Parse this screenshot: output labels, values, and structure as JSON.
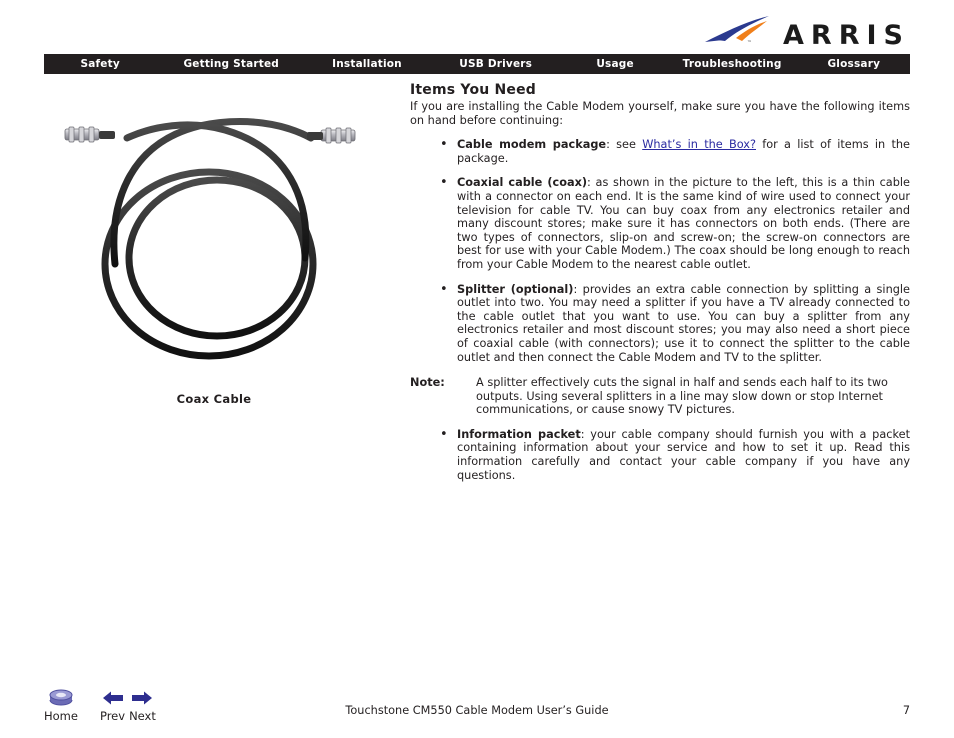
{
  "brand": {
    "name": "ARRIS",
    "swoosh_blue": "#2b3a8f",
    "swoosh_orange": "#f07f1a",
    "wordmark_color": "#1b1b1b"
  },
  "nav": {
    "background": "#231f20",
    "text_color": "#ffffff",
    "items": [
      {
        "label": "Safety"
      },
      {
        "label": "Getting Started"
      },
      {
        "label": "Installation"
      },
      {
        "label": "USB Drivers"
      },
      {
        "label": "Usage"
      },
      {
        "label": "Troubleshooting"
      },
      {
        "label": "Glossary"
      }
    ]
  },
  "figure": {
    "caption": "Coax Cable",
    "alt": "coax-cable-photo",
    "cable_color": "#2b2b2b",
    "connector_color": "#c8c8cc"
  },
  "content": {
    "heading": "Items You Need",
    "intro": "If you are installing the Cable Modem yourself, make sure you have the following items on hand before continuing:",
    "bullets": [
      {
        "term": "Cable modem package",
        "text_before_link": ": see ",
        "link_text": "What’s in the Box?",
        "text_after_link": " for a list of items in the package."
      },
      {
        "term": "Coaxial cable (coax)",
        "text": ": as shown in the picture to the left, this is a thin cable with a connector on each end. It is the same kind of wire used to connect your television for cable TV. You can buy coax from any electronics retailer and many discount stores; make sure it has connectors on both ends. (There are two types of connectors, slip-on and screw-on; the screw-on connectors are best for use with your Cable Modem.) The coax should be long enough to reach from your Cable Modem to the nearest cable outlet."
      },
      {
        "term": "Splitter (optional)",
        "text": ": provides an extra cable connection by splitting a single outlet into two. You may need a splitter if you have a TV already connected to the cable outlet that you want to use. You can buy a splitter from any electronics retailer and most discount stores; you may also need a short piece of coaxial cable (with connectors); use it to connect the splitter to the cable outlet and then connect the Cable Modem and TV to the splitter."
      }
    ],
    "note": {
      "label": "Note:",
      "text": "A splitter effectively cuts the signal in half and sends each half to its two outputs. Using several splitters in a line may slow down or stop Internet communications, or cause snowy TV pictures."
    },
    "bullets_after_note": [
      {
        "term": "Information packet",
        "text": ": your cable company should furnish you with a packet containing information about your service and how to set it up. Read this information carefully and contact your cable company if you have any questions."
      }
    ],
    "link_color": "#2a2aa0"
  },
  "footer": {
    "home_label": "Home",
    "prev_label": "Prev",
    "next_label": "Next",
    "home_icon": "home-disc-icon",
    "prev_icon": "arrow-left-icon",
    "next_icon": "arrow-right-icon",
    "arrow_color": "#2e2e8f",
    "title": "Touchstone CM550 Cable Modem User’s Guide",
    "page_number": "7"
  }
}
